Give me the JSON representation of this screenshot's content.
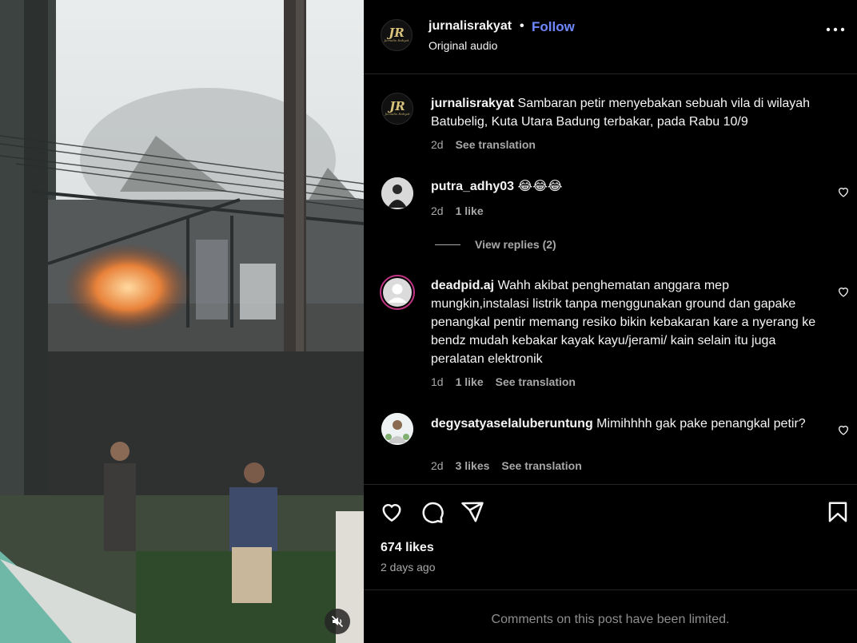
{
  "post": {
    "author": "jurnalisrakyat",
    "separator": "•",
    "follow_label": "Follow",
    "audio_label": "Original audio",
    "logo_text": "JR",
    "logo_subtext": "Jurnalis Rakyat"
  },
  "caption": {
    "username": "jurnalisrakyat",
    "text": "Sambaran petir menyebakan sebuah vila di wilayah Batubelig, Kuta Utara Badung terbakar, pada Rabu 10/9",
    "time": "2d",
    "translate_label": "See translation"
  },
  "comments": [
    {
      "username": "putra_adhy03",
      "text": "😂😂😂",
      "time": "2d",
      "likes": "1 like",
      "view_replies": "View replies (2)"
    },
    {
      "username": "deadpid.aj",
      "text": "Wahh akibat penghematan anggara mep mungkin,instalasi listrik tanpa menggunakan ground dan gapake penangkal pentir memang resiko bikin kebakaran kare a nyerang ke bendz mudah kebakar kayak kayu/jerami/ kain selain itu juga peralatan elektronik",
      "time": "1d",
      "likes": "1 like",
      "translate_label": "See translation"
    },
    {
      "username": "degysatyaselaluberuntung",
      "text": "Mimihhhh gak pake penangkal petir?",
      "time": "2d",
      "likes": "3 likes",
      "translate_label": "See translation"
    }
  ],
  "footer": {
    "likes_count": "674 likes",
    "posted_ago": "2 days ago",
    "limited_notice": "Comments on this post have been limited."
  },
  "icons": {
    "more": "more-options-icon",
    "like": "heart-icon",
    "comment": "comment-icon",
    "share": "share-icon",
    "save": "bookmark-icon",
    "mute": "muted-speaker-icon"
  },
  "colors": {
    "follow": "#6f88ff",
    "secondary_text": "#a8a8a8",
    "background": "#000000",
    "story_ring": "#c13584"
  }
}
